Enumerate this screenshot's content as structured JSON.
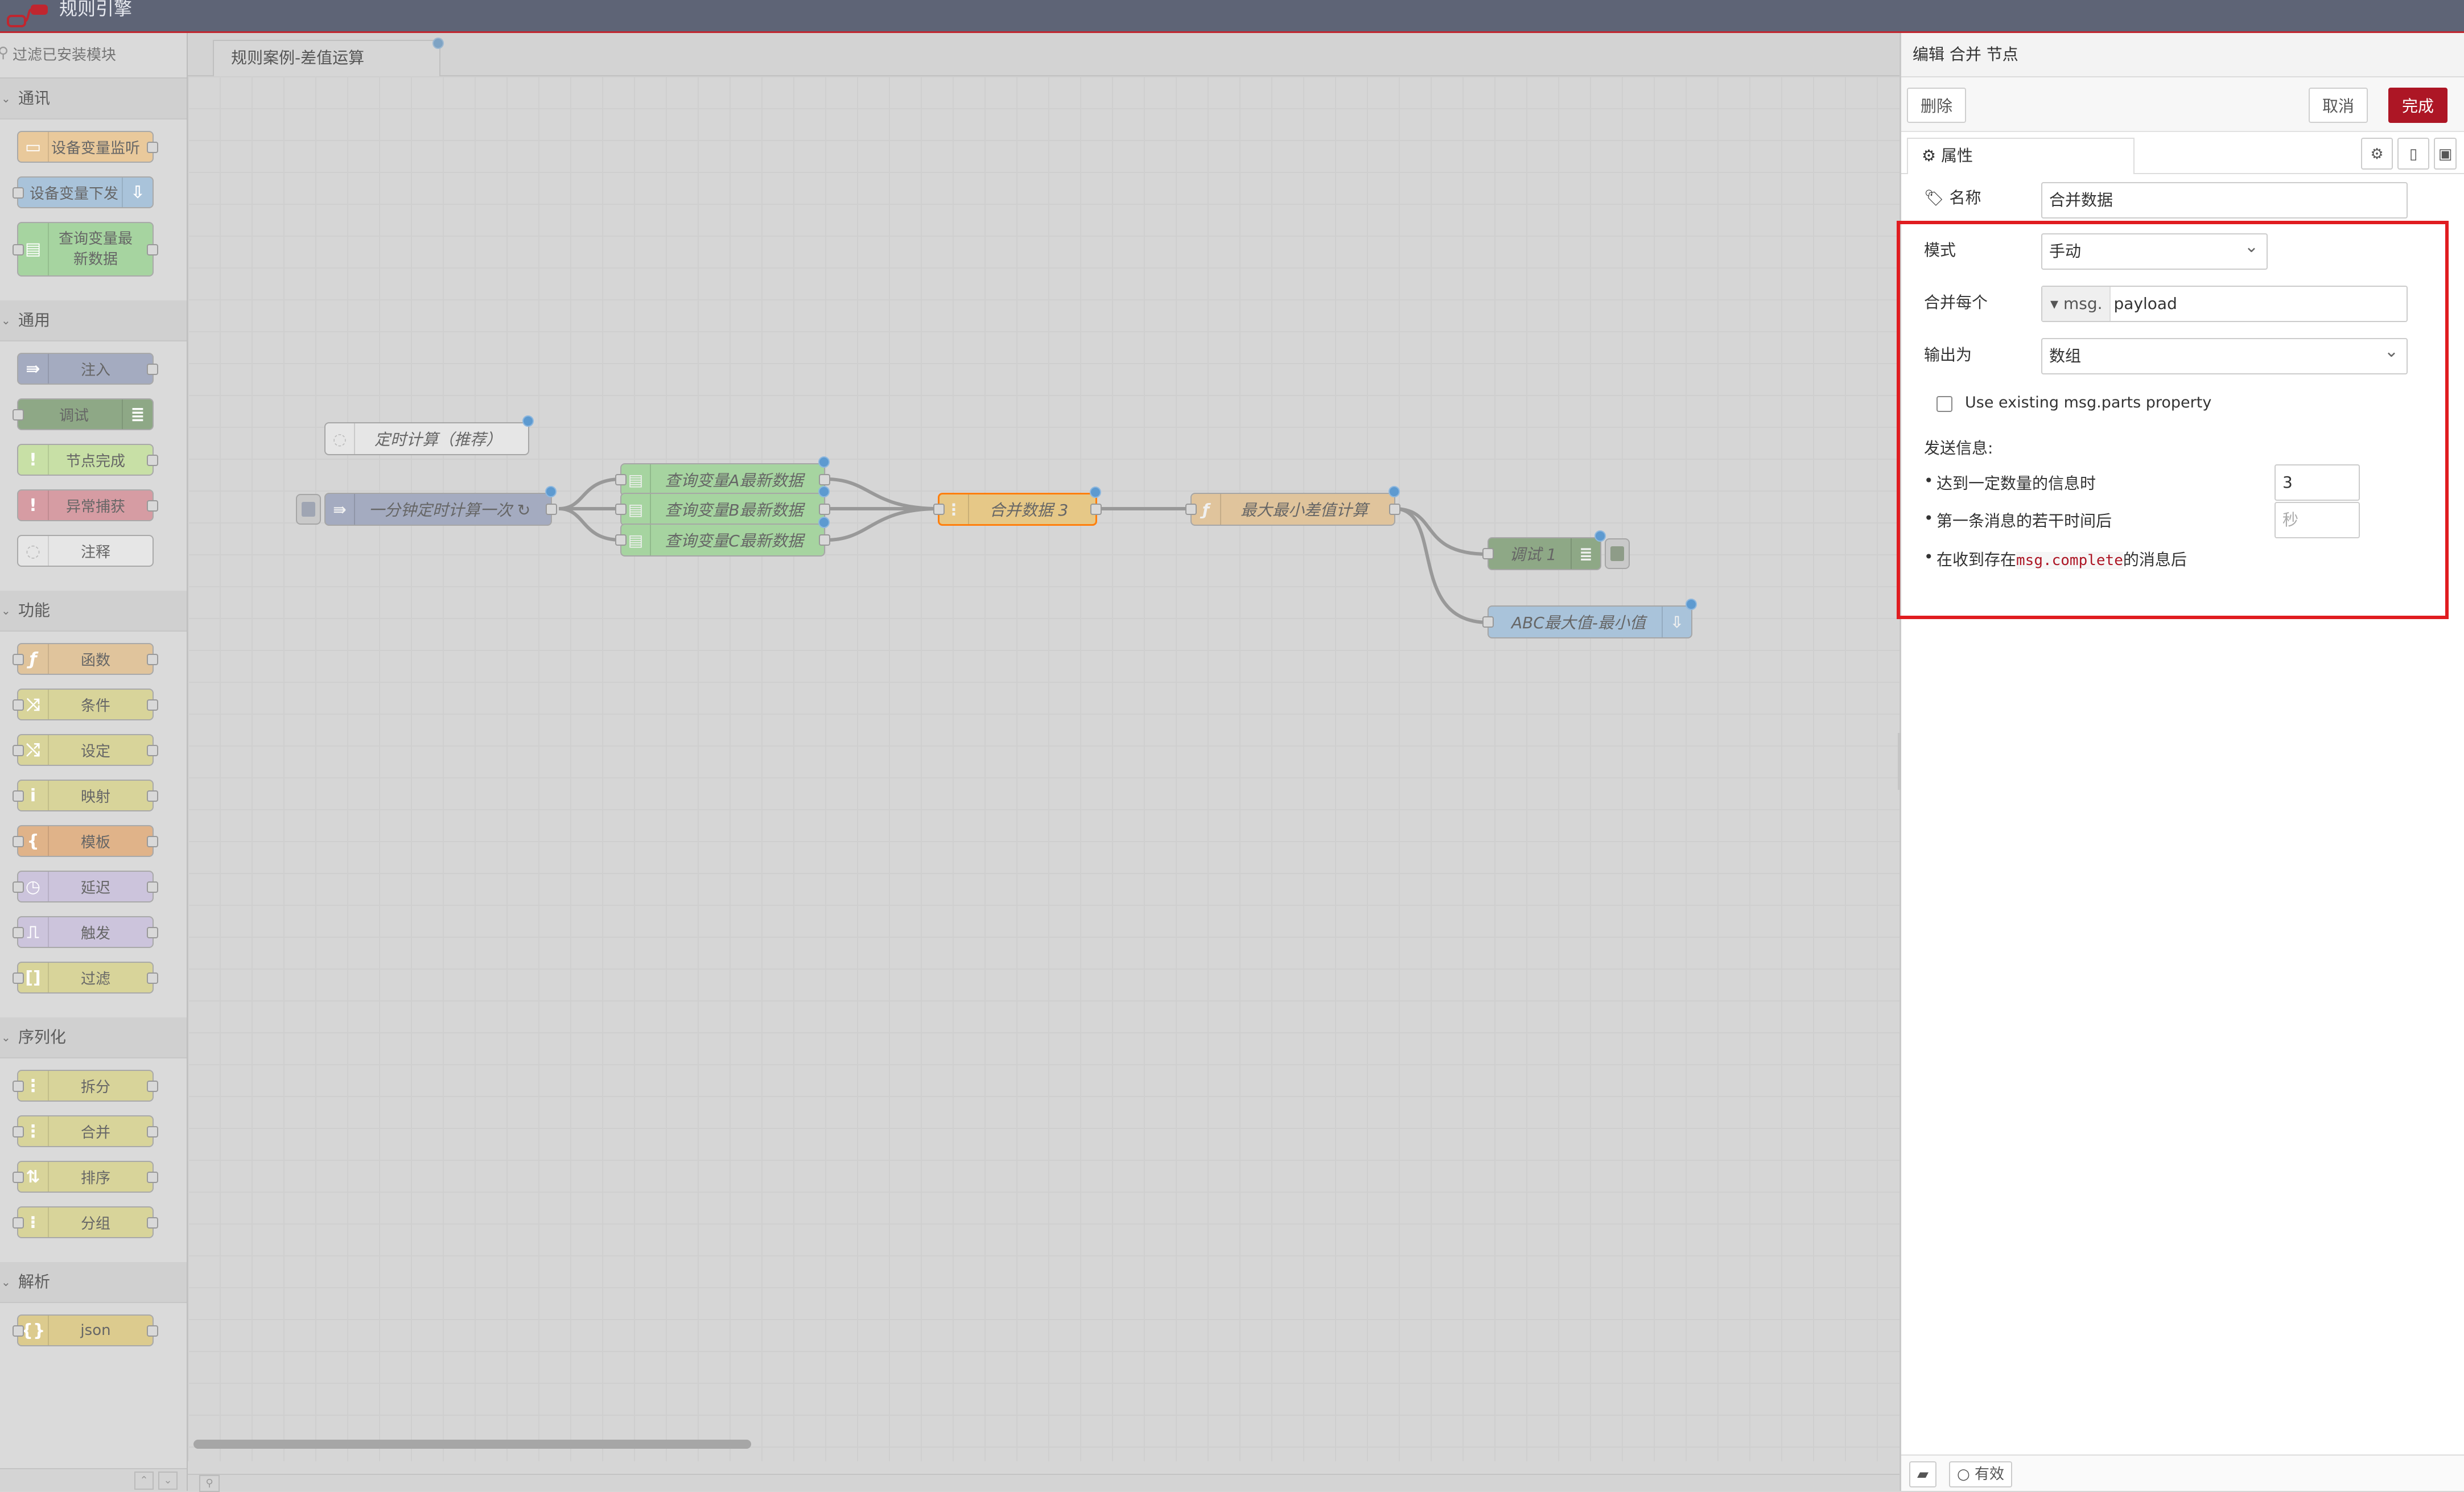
{
  "header": {
    "title": "规则引擎"
  },
  "palette": {
    "filter_placeholder": "过滤已安装模块",
    "categories": [
      {
        "name": "通讯",
        "nodes": [
          "设备变量监听",
          "设备变量下发",
          "查询变量最新数据"
        ]
      },
      {
        "name": "通用",
        "nodes": [
          "注入",
          "调试",
          "节点完成",
          "异常捕获",
          "注释"
        ]
      },
      {
        "name": "功能",
        "nodes": [
          "函数",
          "条件",
          "设定",
          "映射",
          "模板",
          "延迟",
          "触发",
          "过滤"
        ]
      },
      {
        "name": "序列化",
        "nodes": [
          "拆分",
          "合并",
          "排序",
          "分组"
        ]
      },
      {
        "name": "解析",
        "nodes": [
          "json"
        ]
      }
    ]
  },
  "workspace": {
    "tab": "规则案例-差值运算",
    "nodes": {
      "comment": "定时计算（推荐）",
      "inject": "一分钟定时计算一次 ↻",
      "queryA": "查询变量A最新数据",
      "queryB": "查询变量B最新数据",
      "queryC": "查询变量C最新数据",
      "join": "合并数据 3",
      "func": "最大最小差值计算",
      "debug": "调试 1",
      "out": "ABC最大值-最小值"
    }
  },
  "tray": {
    "title": "编辑 合并 节点",
    "delete": "删除",
    "cancel": "取消",
    "done": "完成",
    "tab_properties": "属性",
    "name_label": "名称",
    "name_value": "合并数据",
    "mode_label": "模式",
    "mode_value": "手动",
    "combine_label": "合并每个",
    "combine_type": "msg.",
    "combine_value": "payload",
    "output_label": "输出为",
    "output_value": "数组",
    "use_parts_label": "Use existing msg.parts property",
    "send_label": "发送信息:",
    "after_count_label": "达到一定数量的信息时",
    "after_count_value": "3",
    "after_time_label": "第一条消息的若干时间后",
    "after_time_placeholder": "秒",
    "after_complete_prefix": "在收到存在",
    "after_complete_code": "msg.complete",
    "after_complete_suffix": "的消息后",
    "enabled": "有效"
  },
  "colors": {
    "header_bg": "#5e6476",
    "accent_red": "#ad1625",
    "highlight_red": "#e01c20",
    "selected_orange": "#ff7f0e",
    "change_dot_blue": "#5d9ad0"
  }
}
